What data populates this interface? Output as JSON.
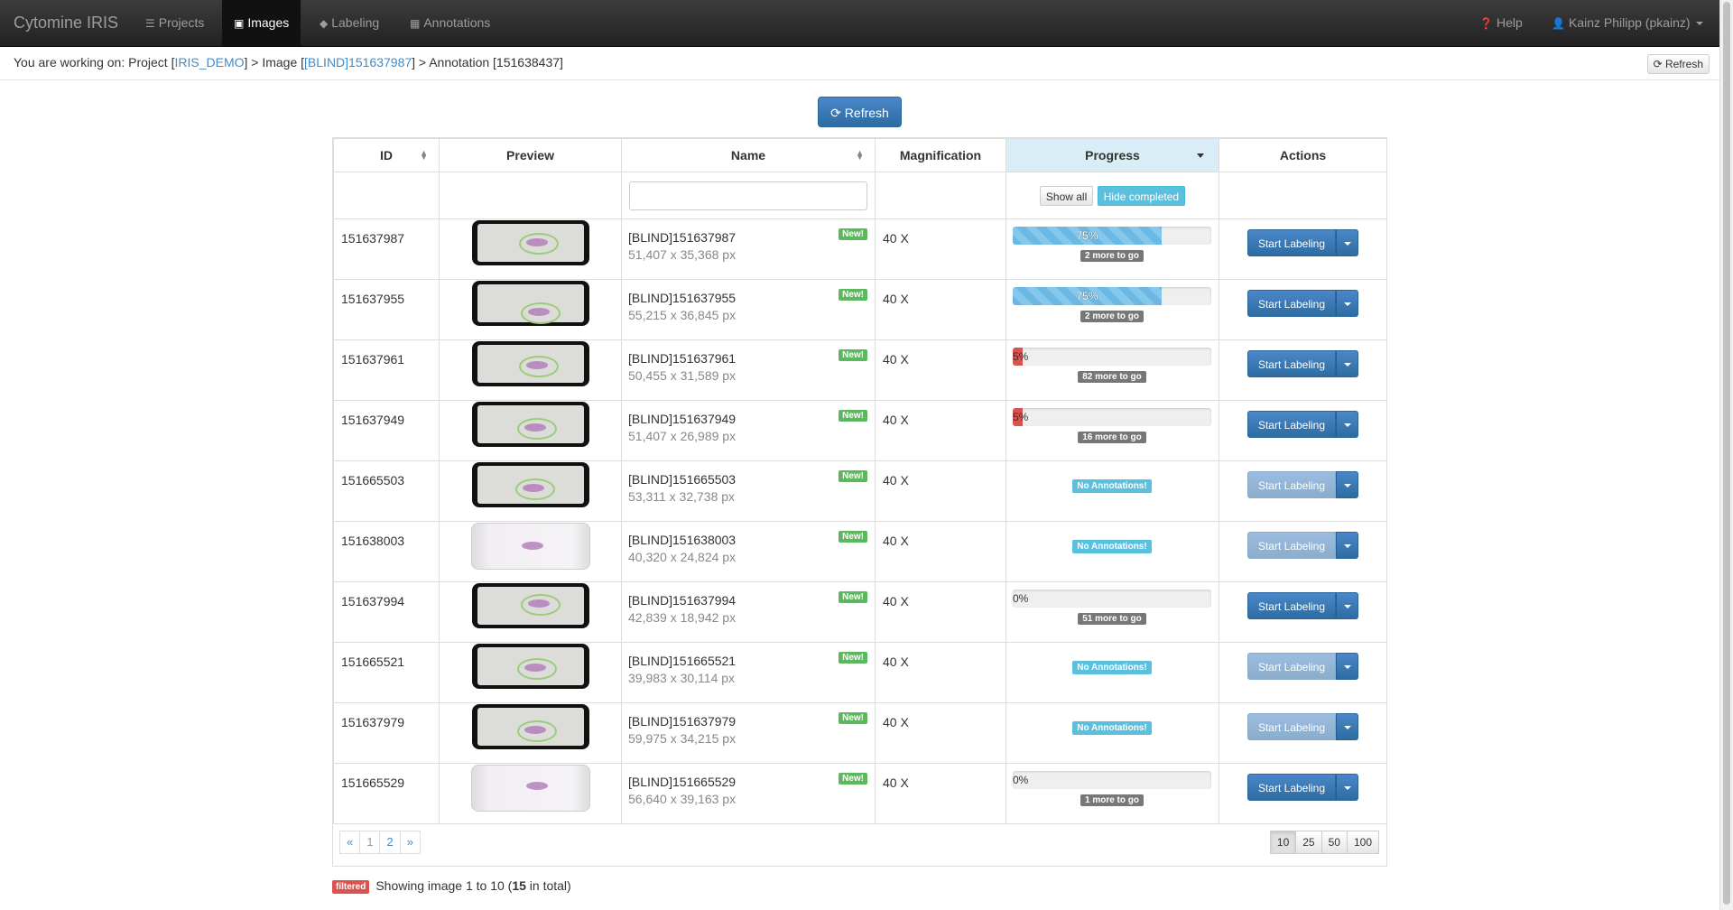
{
  "navbar": {
    "brand": "Cytomine IRIS",
    "items": [
      {
        "label": "Projects",
        "icon": "list-icon"
      },
      {
        "label": "Images",
        "icon": "picture-icon"
      },
      {
        "label": "Labeling",
        "icon": "tag-icon"
      },
      {
        "label": "Annotations",
        "icon": "grid-icon"
      }
    ],
    "active": "Images",
    "help": "Help",
    "user": "Kainz Philipp (pkainz)"
  },
  "breadcrumb": {
    "prefix": "You are working on: Project [",
    "project": "IRIS_DEMO",
    "mid": "] > Image [",
    "image": "[BLIND]151637987",
    "suffix": "] > Annotation [151638437]",
    "refresh": "Refresh"
  },
  "refresh_button": "Refresh",
  "table": {
    "headers": {
      "id": "ID",
      "preview": "Preview",
      "name": "Name",
      "magnification": "Magnification",
      "progress": "Progress",
      "actions": "Actions"
    },
    "filter": {
      "name_placeholder": "",
      "show_all": "Show all",
      "hide_completed": "Hide completed"
    },
    "new_label": "New!",
    "action_label": "Start Labeling",
    "rows": [
      {
        "id": "151637987",
        "name": "[BLIND]151637987",
        "dims": "51,407 x 35,368 px",
        "mag": "40 X",
        "progress": 0.75,
        "progress_text": "75%",
        "status": "2 more to go",
        "annotated": true
      },
      {
        "id": "151637955",
        "name": "[BLIND]151637955",
        "dims": "55,215 x 36,845 px",
        "mag": "40 X",
        "progress": 0.75,
        "progress_text": "75%",
        "status": "2 more to go",
        "annotated": true
      },
      {
        "id": "151637961",
        "name": "[BLIND]151637961",
        "dims": "50,455 x 31,589 px",
        "mag": "40 X",
        "progress": 0.05,
        "progress_text": "5%",
        "status": "82 more to go",
        "annotated": true
      },
      {
        "id": "151637949",
        "name": "[BLIND]151637949",
        "dims": "51,407 x 26,989 px",
        "mag": "40 X",
        "progress": 0.05,
        "progress_text": "5%",
        "status": "16 more to go",
        "annotated": true
      },
      {
        "id": "151665503",
        "name": "[BLIND]151665503",
        "dims": "53,311 x 32,738 px",
        "mag": "40 X",
        "progress": null,
        "progress_text": "",
        "status": "No Annotations!",
        "annotated": false
      },
      {
        "id": "151638003",
        "name": "[BLIND]151638003",
        "dims": "40,320 x 24,824 px",
        "mag": "40 X",
        "progress": null,
        "progress_text": "",
        "status": "No Annotations!",
        "annotated": false
      },
      {
        "id": "151637994",
        "name": "[BLIND]151637994",
        "dims": "42,839 x 18,942 px",
        "mag": "40 X",
        "progress": 0.0,
        "progress_text": "0%",
        "status": "51 more to go",
        "annotated": true
      },
      {
        "id": "151665521",
        "name": "[BLIND]151665521",
        "dims": "39,983 x 30,114 px",
        "mag": "40 X",
        "progress": null,
        "progress_text": "",
        "status": "No Annotations!",
        "annotated": false
      },
      {
        "id": "151637979",
        "name": "[BLIND]151637979",
        "dims": "59,975 x 34,215 px",
        "mag": "40 X",
        "progress": null,
        "progress_text": "",
        "status": "No Annotations!",
        "annotated": false
      },
      {
        "id": "151665529",
        "name": "[BLIND]151665529",
        "dims": "56,640 x 39,163 px",
        "mag": "40 X",
        "progress": 0.0,
        "progress_text": "0%",
        "status": "1 more to go",
        "annotated": true
      }
    ],
    "thumb_styles": [
      "dark",
      "dark",
      "dark",
      "dark",
      "dark",
      "light",
      "dark",
      "dark",
      "dark",
      "light"
    ]
  },
  "pagination": {
    "prev": "«",
    "pages": [
      "1",
      "2"
    ],
    "current": "1",
    "next": "»",
    "sizes": [
      "10",
      "25",
      "50",
      "100"
    ],
    "selected_size": "10"
  },
  "footer": {
    "badge": "filtered",
    "pre": "Showing image 1 to 10 (",
    "total": "15",
    "post": " in total)"
  },
  "colors": {
    "navbar": "#222222",
    "primary": "#428bca",
    "success": "#5cb85c",
    "info": "#5bc0de",
    "danger": "#d9534f",
    "progress_blue": "#6bb8e4"
  }
}
